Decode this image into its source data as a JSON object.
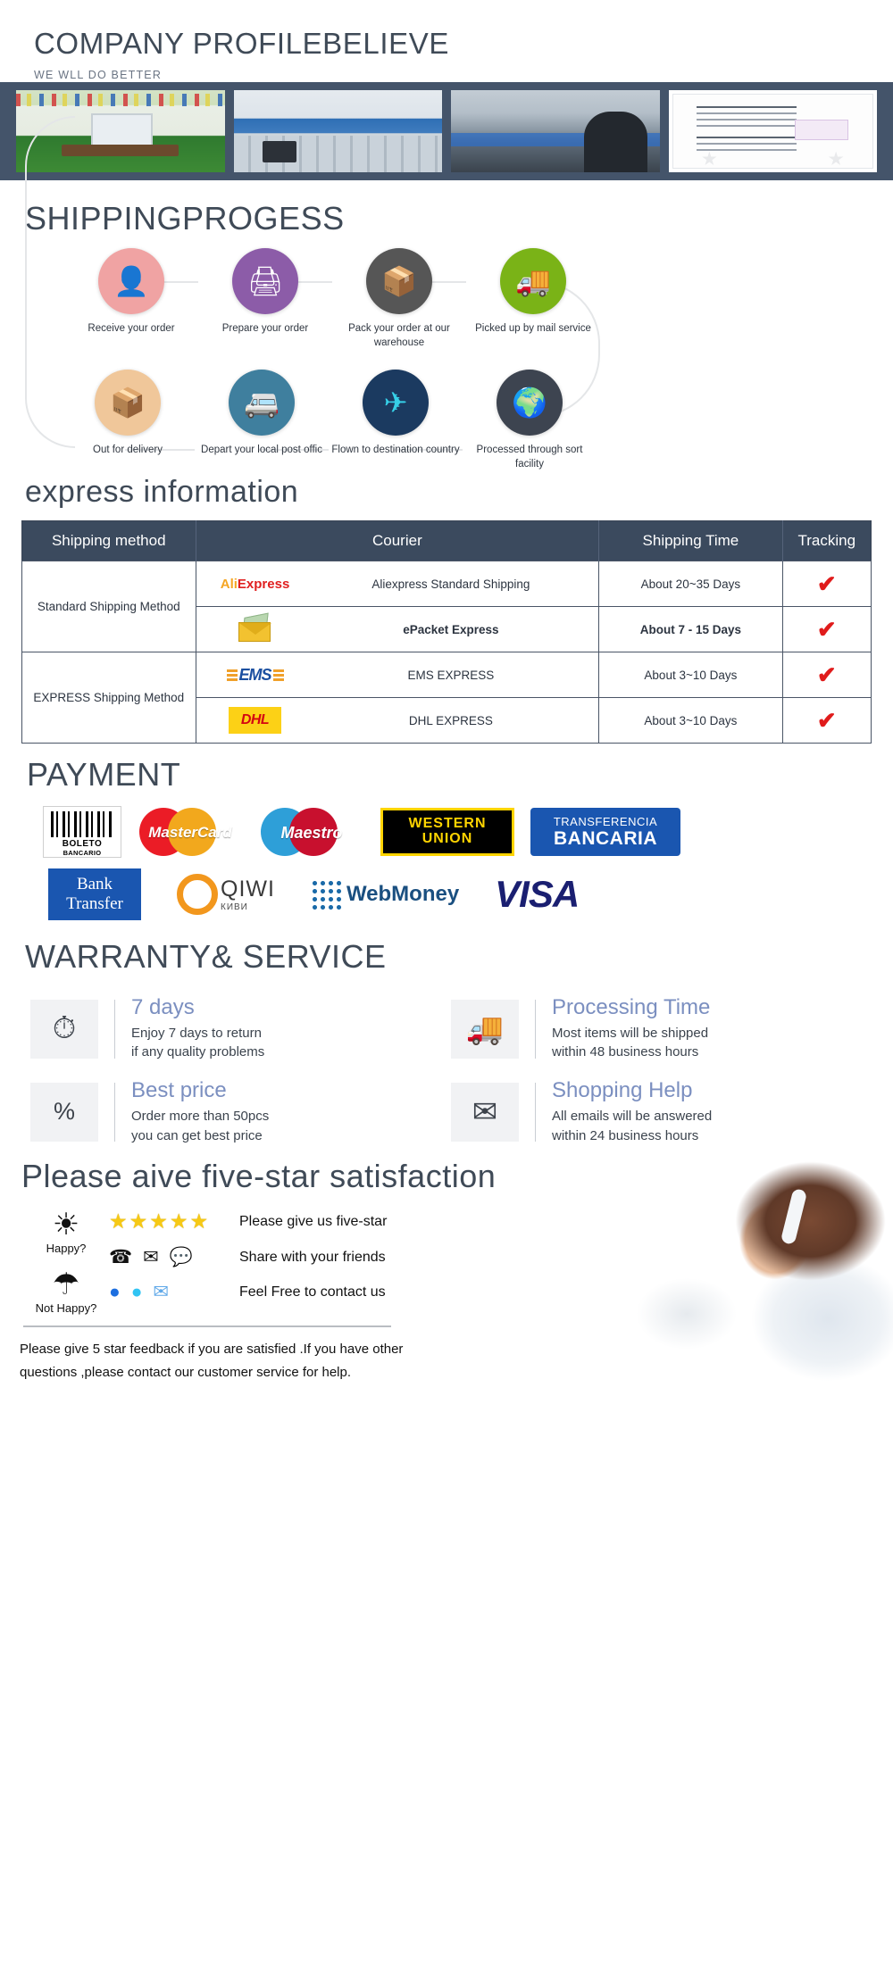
{
  "header": {
    "title": "COMPANY PROFILEBELIEVE",
    "subtitle": "WE WLL DO BETTER",
    "band_color": "#44546a",
    "photos": [
      {
        "name": "showroom"
      },
      {
        "name": "office"
      },
      {
        "name": "production-line"
      },
      {
        "name": "certificate"
      }
    ]
  },
  "shipping": {
    "title": "SHIPPINGPROGESS",
    "steps": [
      {
        "label": "Receive your order",
        "icon": "person-desk-icon",
        "color": "#f0a3a3",
        "glyph": "ᾝ1"
      },
      {
        "label": "Prepare your order",
        "icon": "printer-icon",
        "color": "#8c5ca8",
        "glyph": "⎙"
      },
      {
        "label": "Pack your order at our warehouse",
        "icon": "worker-box-icon",
        "color": "#565656",
        "glyph": "὎6"
      },
      {
        "label": "Picked up by mail service",
        "icon": "truck-icon",
        "color": "#7ab317",
        "glyph": "ὩA"
      },
      {
        "label": "Out for delivery",
        "icon": "open-box-icon",
        "color": "#f0c79a",
        "glyph": "὎6"
      },
      {
        "label": "Depart your local post offic",
        "icon": "van-icon",
        "color": "#3f7f9e",
        "glyph": "Ὡ0"
      },
      {
        "label": "Flown to destination country",
        "icon": "airplane-icon",
        "color": "#1b3a60",
        "glyph": "✈"
      },
      {
        "label": "Processed through sort facility",
        "icon": "globe-icon",
        "color": "#3d4450",
        "glyph": "ἱ0"
      }
    ]
  },
  "express": {
    "title": "express information",
    "columns": [
      "Shipping method",
      "Courier",
      "Shipping Time",
      "Tracking"
    ],
    "groups": [
      {
        "method": "Standard Shipping Method",
        "rows": [
          {
            "logo": "aliexpress-logo",
            "courier": "Aliexpress Standard Shipping",
            "time": "About 20~35 Days",
            "tracking": "✔",
            "bold": false
          },
          {
            "logo": "epacket-logo",
            "courier": "ePacket Express",
            "time": "About 7 - 15 Days",
            "tracking": "✔",
            "bold": true
          }
        ]
      },
      {
        "method": "EXPRESS Shipping Method",
        "rows": [
          {
            "logo": "ems-logo",
            "courier": "EMS EXPRESS",
            "time": "About 3~10 Days",
            "tracking": "✔",
            "bold": false
          },
          {
            "logo": "dhl-logo",
            "courier": "DHL EXPRESS",
            "time": "About 3~10 Days",
            "tracking": "✔",
            "bold": false
          }
        ]
      }
    ],
    "logo_text": {
      "aliexpress_a": "Ali",
      "aliexpress_b": "Express",
      "ems": "EMS",
      "dhl": "DHL"
    }
  },
  "payment": {
    "title": "PAYMENT",
    "row1": [
      {
        "name": "boleto-bancario-logo",
        "line1": "BOLETO",
        "line2": "BANCARIO"
      },
      {
        "name": "mastercard-logo",
        "text": "MasterCard"
      },
      {
        "name": "maestro-logo",
        "text": "Maestro"
      },
      {
        "name": "western-union-logo",
        "line1": "WESTERN",
        "line2": "UNION"
      },
      {
        "name": "transferencia-bancaria-logo",
        "line1": "TRANSFERENCIA",
        "line2": "BANCARIA"
      }
    ],
    "row2": [
      {
        "name": "bank-transfer-logo",
        "line1": "Bank",
        "line2": "Transfer"
      },
      {
        "name": "qiwi-logo",
        "line1": "QIWI",
        "line2": "КИВИ"
      },
      {
        "name": "webmoney-logo",
        "text": "WebMoney"
      },
      {
        "name": "visa-logo",
        "text": "VISA"
      }
    ]
  },
  "warranty": {
    "title": "WARRANTY& SERVICE",
    "accent_color": "#7b8fc0",
    "cards": [
      {
        "icon": "clock-return-icon",
        "glyph": "⏱",
        "heading": "7 days",
        "line1": "Enjoy 7 days to return",
        "line2": "if any quality problems"
      },
      {
        "icon": "delivery-truck-icon",
        "glyph": "ὩA",
        "heading": "Processing Time",
        "line1": "Most items will be shipped",
        "line2": "within 48 business hours"
      },
      {
        "icon": "discount-icon",
        "glyph": "%",
        "heading": "Best price",
        "line1": "Order more than 50pcs",
        "line2": "you can get best price"
      },
      {
        "icon": "envelope-icon",
        "glyph": "✉",
        "heading": "Shopping Help",
        "line1": "All emails will be answered",
        "line2": "within 24 business hours"
      }
    ]
  },
  "feedback": {
    "title": "Please aive five-star satisfaction",
    "moods": [
      {
        "icon": "sun-icon",
        "glyph": "☀",
        "caption": "Happy?"
      },
      {
        "icon": "rain-cloud-icon",
        "glyph": "☔",
        "caption": "Not Happy?"
      }
    ],
    "rows": [
      {
        "type": "stars",
        "count": 5,
        "star_glyph": "★",
        "text": "Please give us five-star"
      },
      {
        "type": "icons",
        "icons": [
          "phone-icon",
          "mail-icon",
          "chat-icon"
        ],
        "glyphs": [
          "☎",
          "✉",
          "ὊC"
        ],
        "text": "Share with your friends"
      },
      {
        "type": "icons",
        "icons": [
          "messenger-icon",
          "skype-icon",
          "email-icon"
        ],
        "glyphs": [
          "●",
          "S",
          "✉"
        ],
        "text": "Feel Free to contact us"
      }
    ],
    "note_line1": "Please give 5 star feedback if you are satisfied .If you have other",
    "note_line2": "questions ,please contact our customer service for help.",
    "photo": "customer-service-agent-photo"
  }
}
